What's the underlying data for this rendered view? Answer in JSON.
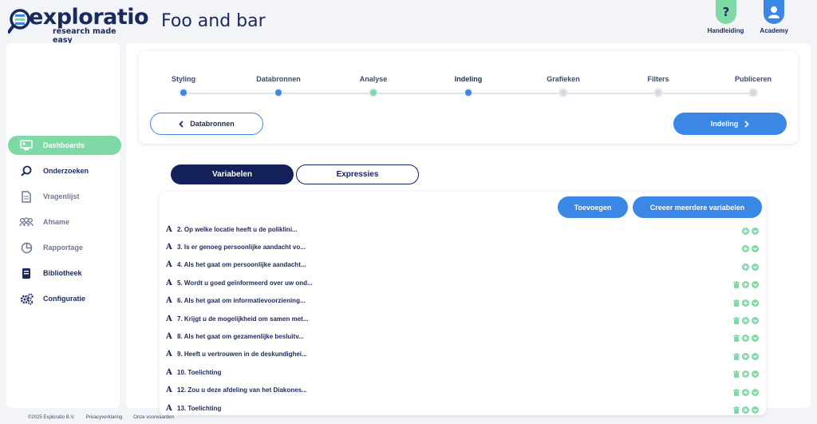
{
  "logo": {
    "word": "exploratio",
    "tagline": "research made easy"
  },
  "page_title": "Foo and bar",
  "top_actions": [
    {
      "label": "Handleiding",
      "icon": "question-icon",
      "color": "#7ed9a7"
    },
    {
      "label": "Academy",
      "icon": "user-icon",
      "color": "#3a87e6"
    }
  ],
  "sidebar": {
    "items": [
      {
        "label": "Dashboards",
        "icon": "dashboard-icon",
        "active": true
      },
      {
        "label": "Onderzoeken",
        "icon": "search-icon",
        "active": false
      },
      {
        "label": "Vragenlijst",
        "icon": "document-icon",
        "active": false
      },
      {
        "label": "Afname",
        "icon": "group-icon",
        "active": false
      },
      {
        "label": "Rapportage",
        "icon": "pie-chart-icon",
        "active": false
      },
      {
        "label": "Bibliotheek",
        "icon": "library-icon",
        "active": false
      },
      {
        "label": "Configuratie",
        "icon": "gears-icon",
        "active": false
      }
    ]
  },
  "wizard": {
    "steps": [
      {
        "label": "Styling",
        "state": "done"
      },
      {
        "label": "Databronnen",
        "state": "done"
      },
      {
        "label": "Analyse",
        "state": "success"
      },
      {
        "label": "Indeling",
        "state": "current"
      },
      {
        "label": "Grafieken",
        "state": "todo"
      },
      {
        "label": "Filters",
        "state": "todo"
      },
      {
        "label": "Publiceren",
        "state": "todo"
      }
    ],
    "back_label": "Databronnen",
    "next_label": "Indeling"
  },
  "tabs": [
    {
      "label": "Variabelen",
      "active": true
    },
    {
      "label": "Expressies",
      "active": false
    }
  ],
  "panel": {
    "add_label": "Toevoegen",
    "multi_label": "Creeer meerdere variabelen",
    "rows": [
      {
        "type": "A",
        "name": "2. Op welke locatie heeft u de poliklini...",
        "deletable": false
      },
      {
        "type": "A",
        "name": "3. Is er genoeg persoonlijke aandacht vo...",
        "deletable": false
      },
      {
        "type": "A",
        "name": "4. Als het gaat om persoonlijke aandacht...",
        "deletable": false
      },
      {
        "type": "A",
        "name": "5. Wordt u goed geïnformeerd over uw ond...",
        "deletable": true
      },
      {
        "type": "A",
        "name": "6. Als het gaat om informatievoorziening...",
        "deletable": true
      },
      {
        "type": "A",
        "name": "7. Krijgt u de mogelijkheid om samen met...",
        "deletable": true
      },
      {
        "type": "A",
        "name": "8. Als het gaat om gezamenlijke besluitv...",
        "deletable": true
      },
      {
        "type": "A",
        "name": "9. Heeft u vertrouwen in de deskundighei...",
        "deletable": true
      },
      {
        "type": "A",
        "name": "10. Toelichting",
        "deletable": true
      },
      {
        "type": "A",
        "name": "12. Zou u deze afdeling van het Diakones...",
        "deletable": true
      },
      {
        "type": "A",
        "name": "13. Toelichting",
        "deletable": true
      }
    ]
  },
  "footer": {
    "copyright": "©2025 Exploratio B.V.",
    "privacy": "Privacyverklaring",
    "terms": "Onze voorwaarden"
  },
  "colors": {
    "navy": "#1b2a5c",
    "accent_blue": "#3a87e6",
    "accent_green": "#7ed9a7"
  }
}
